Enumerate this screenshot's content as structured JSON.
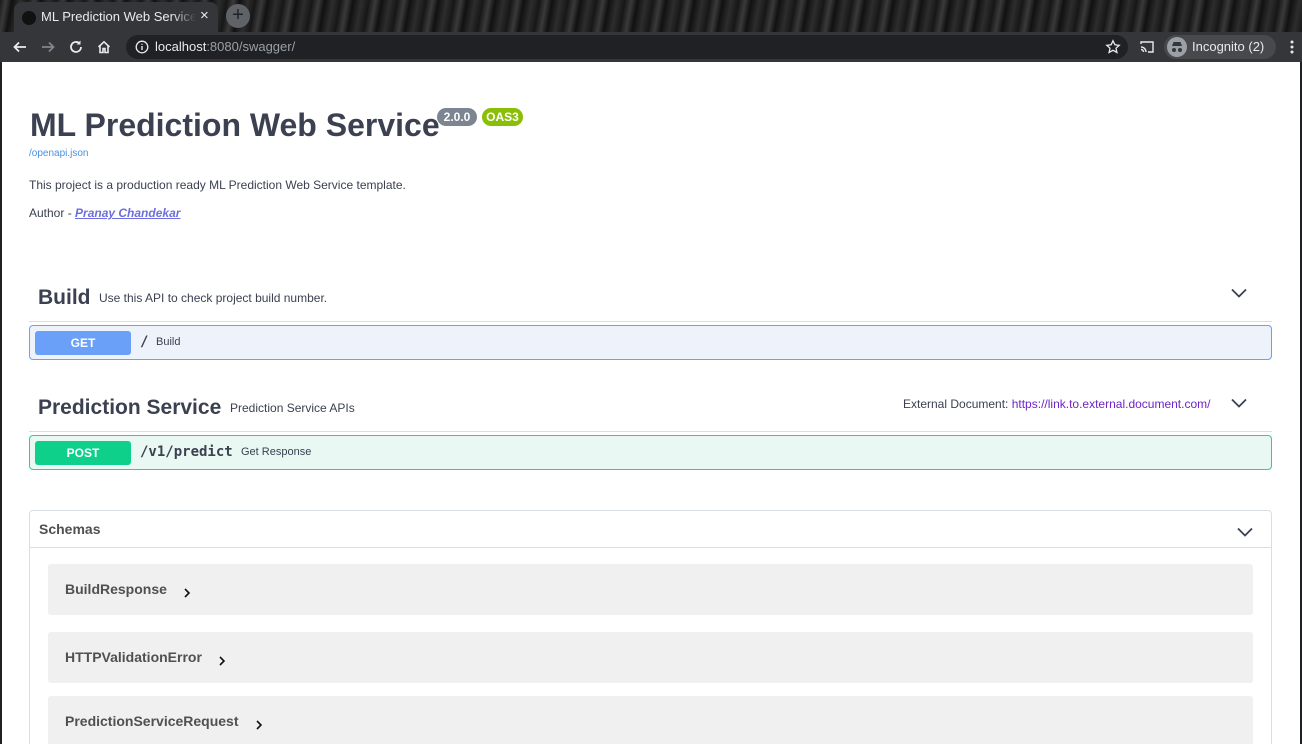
{
  "browser": {
    "tab_title": "ML Prediction Web Service",
    "tab_close": "×",
    "new_tab": "+",
    "url_host": "localhost",
    "url_rest": ":8080/swagger/",
    "profile_label": "Incognito (2)"
  },
  "info": {
    "title": "ML Prediction Web Service",
    "version_badge": "2.0.0",
    "oas_badge": "OAS3",
    "spec_link": "/openapi.json",
    "description": "This project is a production ready ML Prediction Web Service template.",
    "author_prefix": "Author - ",
    "author_name": "Pranay Chandekar"
  },
  "tags": [
    {
      "name": "Build",
      "description": "Use this API to check project build number.",
      "operations": [
        {
          "method": "GET",
          "path": "/",
          "summary": "Build"
        }
      ]
    },
    {
      "name": "Prediction Service",
      "description": "Prediction Service APIs",
      "external_doc_label": "External Document: ",
      "external_doc_url": "https://link.to.external.document.com/",
      "operations": [
        {
          "method": "POST",
          "path": "/v1/predict",
          "summary": "Get Response"
        }
      ]
    }
  ],
  "schemas": {
    "title": "Schemas",
    "items": [
      "BuildResponse",
      "HTTPValidationError",
      "PredictionServiceRequest"
    ]
  },
  "colors": {
    "get": "#6aa0f8",
    "post": "#0fd08a",
    "version_badge": "#7d8492",
    "oas_badge": "#89bf04"
  }
}
